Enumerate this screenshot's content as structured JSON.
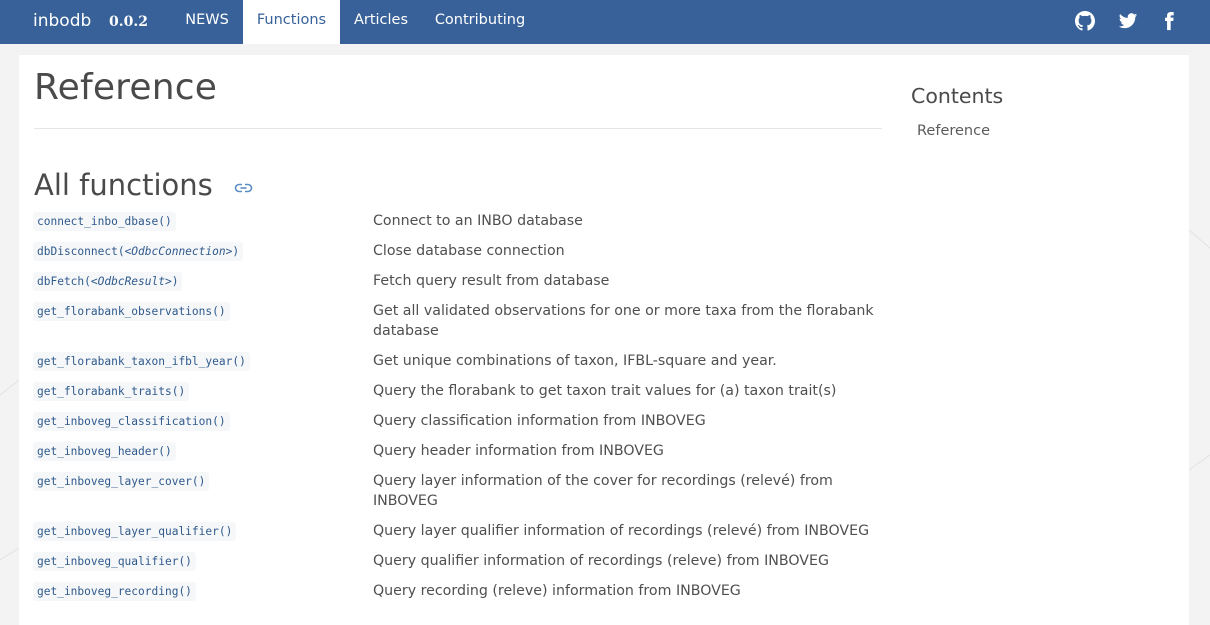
{
  "navbar": {
    "brand": "inbodb",
    "version": "0.0.2",
    "items": [
      "NEWS",
      "Functions",
      "Articles",
      "Contributing"
    ],
    "active": "Functions",
    "social": [
      "github-icon",
      "twitter-icon",
      "facebook-icon"
    ]
  },
  "page": {
    "title": "Reference",
    "section_title": "All functions"
  },
  "functions": [
    {
      "name": "connect_inbo_dbase()",
      "arg": "",
      "desc": "Connect to an INBO database"
    },
    {
      "name": "dbDisconnect(",
      "arg": "<OdbcConnection>",
      "suffix": ")",
      "desc": "Close database connection"
    },
    {
      "name": "dbFetch(",
      "arg": "<OdbcResult>",
      "suffix": ")",
      "desc": "Fetch query result from database"
    },
    {
      "name": "get_florabank_observations()",
      "arg": "",
      "desc": "Get all validated observations for one or more taxa from the florabank database"
    },
    {
      "name": "get_florabank_taxon_ifbl_year()",
      "arg": "",
      "desc": "Get unique combinations of taxon, IFBL-square and year."
    },
    {
      "name": "get_florabank_traits()",
      "arg": "",
      "desc": "Query the florabank to get taxon trait values for (a) taxon trait(s)"
    },
    {
      "name": "get_inboveg_classification()",
      "arg": "",
      "desc": "Query classification information from INBOVEG"
    },
    {
      "name": "get_inboveg_header()",
      "arg": "",
      "desc": "Query header information from INBOVEG"
    },
    {
      "name": "get_inboveg_layer_cover()",
      "arg": "",
      "desc": "Query layer information of the cover for recordings (relevé) from INBOVEG"
    },
    {
      "name": "get_inboveg_layer_qualifier()",
      "arg": "",
      "desc": "Query layer qualifier information of recordings (relevé) from INBOVEG"
    },
    {
      "name": "get_inboveg_qualifier()",
      "arg": "",
      "desc": "Query qualifier information of recordings (releve) from INBOVEG"
    },
    {
      "name": "get_inboveg_recording()",
      "arg": "",
      "desc": "Query recording (releve) information from INBOVEG"
    }
  ],
  "toc": {
    "title": "Contents",
    "items": [
      "Reference"
    ]
  },
  "colors": {
    "navbar": "#376198",
    "background": "#f3f3f3",
    "code": "#2f5a8c",
    "link_icon": "#5b8fc4"
  }
}
